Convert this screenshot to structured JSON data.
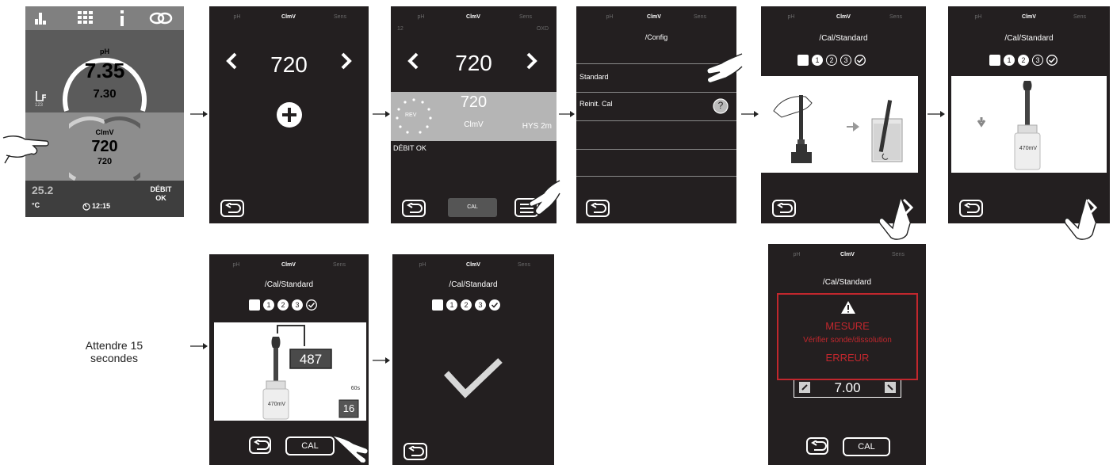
{
  "tabs": {
    "ph": "pH",
    "clmv": "ClmV",
    "sens": "Sens"
  },
  "home": {
    "ph_label": "pH",
    "ph_value": "7.35",
    "ph_setpoint": "7.30",
    "ph_badge": "123",
    "clmv_label": "ClmV",
    "clmv_value": "720",
    "clmv_setpoint": "720",
    "temperature": "25.2",
    "temperature_unit": "°C",
    "time": "12:15",
    "flow_line1": "DÉBIT",
    "flow_line2": "OK"
  },
  "setpoint": {
    "value": "720"
  },
  "detail": {
    "left_label": "12",
    "right_label": "OXD",
    "setpoint_value": "720",
    "measure_value": "720",
    "measure_unit": "ClmV",
    "rev_label": "REV",
    "hys_label": "HYS 2m",
    "flow_status": "DÉBIT OK",
    "cal_button": "CAL"
  },
  "config": {
    "title": "/Config",
    "items": [
      "Standard",
      "Reinit. Cal"
    ],
    "help_glyph": "?"
  },
  "calibration": {
    "title": "/Cal/Standard",
    "steps": [
      "1",
      "2",
      "3"
    ],
    "bottle_label": "470mV",
    "reading": "487",
    "timer_unit": "60s",
    "timer_value": "16",
    "cal_button": "CAL",
    "wait_caption": "Attendre 15 secondes"
  },
  "error": {
    "title": "/Cal/Standard",
    "line1": "MESURE",
    "line2": "Vérifier sonde/dissolution",
    "line3": "ERREUR",
    "value": "7.00",
    "cal_button": "CAL",
    "color": "#c1272d"
  },
  "colors": {
    "screen_bg": "#231f20",
    "home_top": "#5b5b5b",
    "home_mid": "#8d8d8d",
    "home_bot": "#3e3e3e",
    "error": "#c1272d"
  }
}
